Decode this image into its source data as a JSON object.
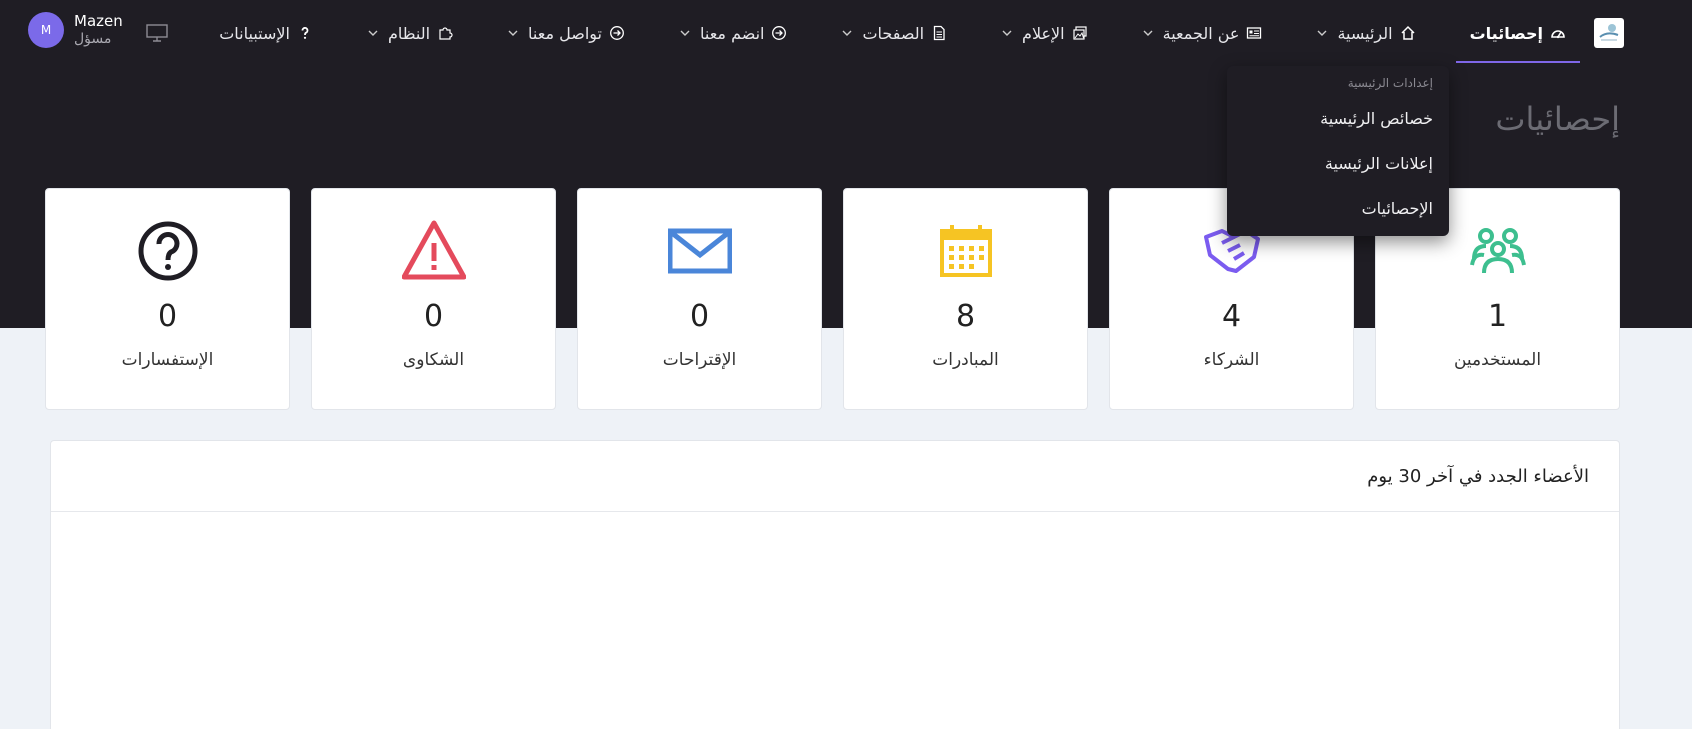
{
  "page_title": "إحصائيات",
  "nav": {
    "items": [
      {
        "label": "إحصائيات",
        "icon": "dashboard-icon",
        "active": true,
        "has_dropdown": false
      },
      {
        "label": "الرئيسية",
        "icon": "home-icon",
        "active": false,
        "has_dropdown": true
      },
      {
        "label": "عن الجمعية",
        "icon": "id-card-icon",
        "active": false,
        "has_dropdown": true
      },
      {
        "label": "الإعلام",
        "icon": "images-icon",
        "active": false,
        "has_dropdown": true
      },
      {
        "label": "الصفحات",
        "icon": "document-icon",
        "active": false,
        "has_dropdown": true
      },
      {
        "label": "انضم معنا",
        "icon": "arrow-circle-icon",
        "active": false,
        "has_dropdown": true
      },
      {
        "label": "تواصل معنا",
        "icon": "arrow-circle-icon",
        "active": false,
        "has_dropdown": true
      },
      {
        "label": "النظام",
        "icon": "puzzle-icon",
        "active": false,
        "has_dropdown": true
      },
      {
        "label": "الإستبيانات",
        "icon": "question-icon",
        "active": false,
        "has_dropdown": false
      }
    ]
  },
  "dropdown": {
    "header": "إعدادات الرئيسية",
    "items": [
      "خصائص الرئيسية",
      "إعلانات الرئيسية",
      "الإحصائيات"
    ]
  },
  "user": {
    "name": "Mazen",
    "role": "مسؤل",
    "avatar_initial": "M"
  },
  "cards": [
    {
      "label": "المستخدمين",
      "value": "1",
      "icon": "users-icon",
      "color": "#3dbf8f"
    },
    {
      "label": "الشركاء",
      "value": "4",
      "icon": "handshake-icon",
      "color": "#7b5cf0"
    },
    {
      "label": "المبادرات",
      "value": "8",
      "icon": "calendar-icon",
      "color": "#f6c423"
    },
    {
      "label": "الإقتراحات",
      "value": "0",
      "icon": "envelope-icon",
      "color": "#4a86d9"
    },
    {
      "label": "الشكاوى",
      "value": "0",
      "icon": "warning-icon",
      "color": "#e44a5c"
    },
    {
      "label": "الإستفسارات",
      "value": "0",
      "icon": "question-circle-icon",
      "color": "#1f1d24"
    }
  ],
  "panel": {
    "title": "الأعضاء الجدد في آخر 30 يوم"
  }
}
